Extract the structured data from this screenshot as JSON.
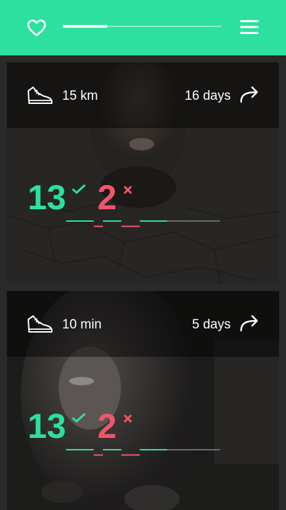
{
  "header": {
    "progress": 0.28,
    "colors": {
      "accent": "#2ee0a0",
      "bar": "#2ee0a0"
    },
    "icons": {
      "left": "heart-icon",
      "right": "menu-icon"
    }
  },
  "cards": [
    {
      "metric": "15 km",
      "days": "16 days",
      "success_count": "13",
      "fail_count": "2",
      "streak": [
        "success",
        "fail",
        "success",
        "fail",
        "success",
        "pending",
        "pending",
        "pending"
      ]
    },
    {
      "metric": "10 min",
      "days": "5 days",
      "success_count": "13",
      "fail_count": "2",
      "streak": [
        "success",
        "fail",
        "success",
        "fail",
        "success",
        "pending",
        "pending",
        "pending"
      ]
    }
  ],
  "colors": {
    "success": "#2ee0a0",
    "fail": "#f0566a",
    "pending": "#6a6a6a"
  }
}
